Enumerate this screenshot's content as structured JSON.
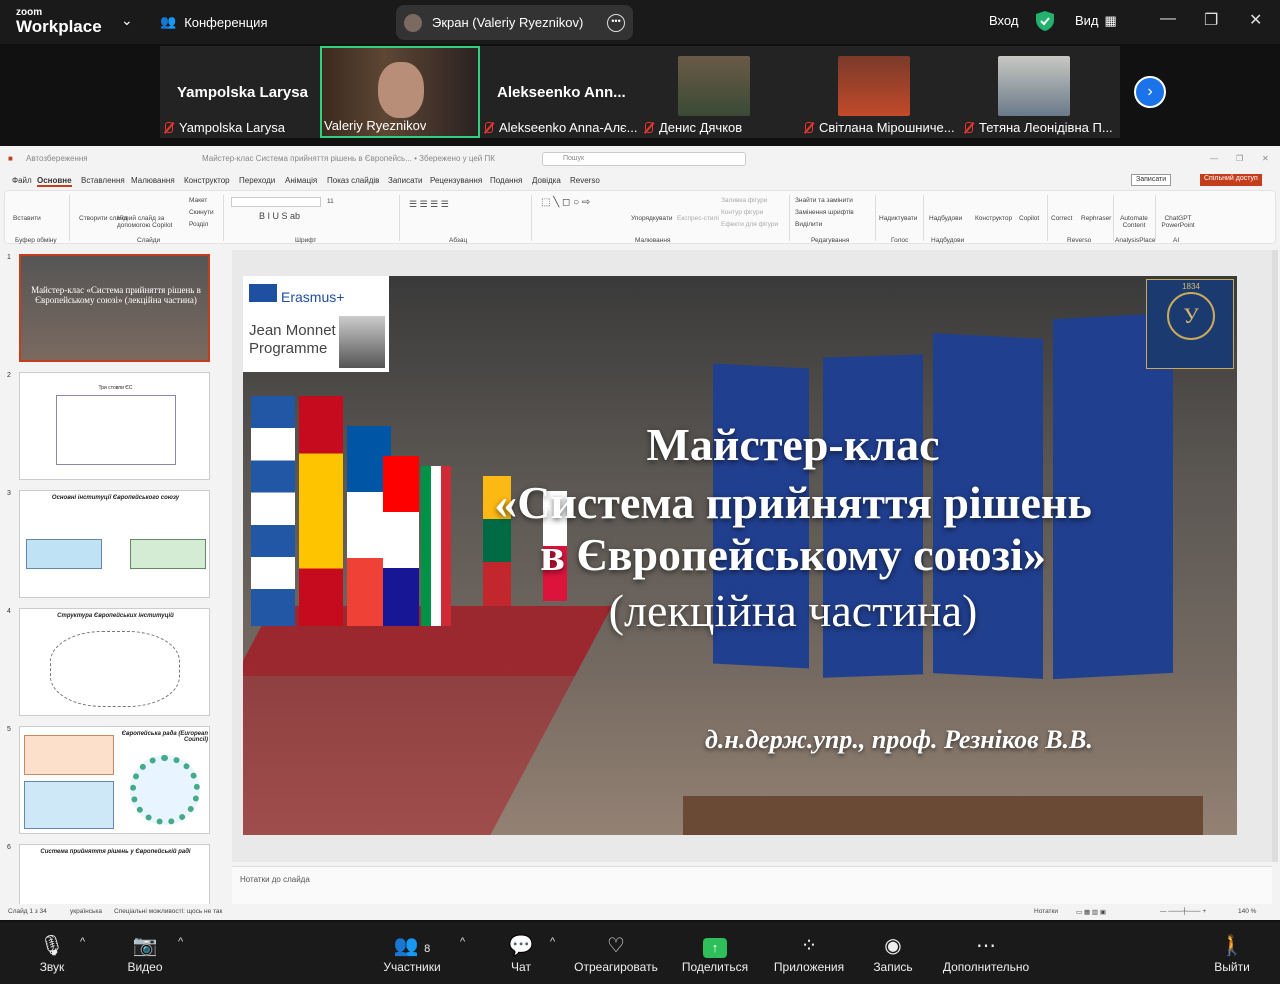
{
  "zoom": {
    "logo_top": "zoom",
    "logo_bottom": "Workplace",
    "conference_label": "Конференция",
    "screen_label": "Экран (Valeriy Ryeznikov)",
    "login_label": "Вход",
    "view_label": "Вид",
    "participants": [
      {
        "name_big": "Yampolska Larysa",
        "label": "Yampolska Larysa"
      },
      {
        "name_big": "",
        "label": "Valeriy Ryeznikov"
      },
      {
        "name_big": "Alekseenko  Ann...",
        "label": "Alekseenko Anna-Алє..."
      },
      {
        "name_big": "",
        "label": "Денис Дячков"
      },
      {
        "name_big": "",
        "label": "Світлана Мірошниче..."
      },
      {
        "name_big": "",
        "label": "Тетяна Леонідівна П..."
      }
    ],
    "toolbar": {
      "audio": "Звук",
      "video": "Видео",
      "participants": "Участники",
      "participants_count": "8",
      "chat": "Чат",
      "react": "Отреагировать",
      "share": "Поделиться",
      "apps": "Приложения",
      "record": "Запись",
      "more": "Дополнительно",
      "leave": "Выйти"
    }
  },
  "ppt": {
    "autosave": "Автозбереження",
    "doc_title": "Майстер-клас Система прийняття рішень в Європейсь... • Збережено у цей ПК",
    "search_placeholder": "Пошук",
    "menu": [
      "Файл",
      "Основне",
      "Вставлення",
      "Малювання",
      "Конструктор",
      "Переходи",
      "Анімація",
      "Показ слайдів",
      "Записати",
      "Рецензування",
      "Подання",
      "Довідка",
      "Reverso"
    ],
    "record_btn": "Записати",
    "share_btn": "Спільний доступ",
    "ribbon_groups": [
      "Буфер обміну",
      "Слайди",
      "Шрифт",
      "Абзац",
      "Малювання",
      "Редагування",
      "Голос",
      "Надбудови",
      "Reverso",
      "AnalysisPlace",
      "AI"
    ],
    "ribbon_buttons": [
      "Вставити",
      "Створити слайд",
      "Новий слайд за допомогою Copilot",
      "Макет",
      "Скинути",
      "Розділ",
      "Упорядкувати",
      "Експрес-стилі",
      "Заливка фігури",
      "Контур фігури",
      "Ефекти для фігури",
      "Знайти та замінити",
      "Замінення шрифтів",
      "Виділити",
      "Надиктувати",
      "Надбудови",
      "Конструктор",
      "Copilot",
      "Correct",
      "Rephraser",
      "Automate Content",
      "ChatGPT PowerPoint"
    ],
    "font_size": "11",
    "slide_numbers": [
      "1",
      "2",
      "3",
      "4",
      "5",
      "6"
    ],
    "thumb_titles": [
      "Майстер-клас «Система прийняття рішень в Європейському союзі» (лекційна частина)",
      "Три стовпи ЄС",
      "Основні інституції Європейського союзу",
      "Структура Європейських інституцій",
      "Європейська рада (European Council)",
      "Система прийняття рішень у Європейській раді"
    ],
    "notes_placeholder": "Нотатки до слайда",
    "status_slide": "Слайд 1 з 34",
    "status_lang": "українська",
    "status_access": "Спеціальні можливості: щось не так",
    "status_notes": "Нотатки",
    "zoom_level": "140 %"
  },
  "slide": {
    "erasmus": "Erasmus+",
    "jean_monnet": "Jean Monnet",
    "programme": "Programme",
    "crest_year": "1834",
    "crest_letter": "У",
    "title_line1": "Майстер-клас",
    "title_line2": "«Система прийняття рішень",
    "title_line3": "в Європейському союзі»",
    "title_line4": "(лекційна частина)",
    "author": "д.н.держ.упр., проф. Резніков В.В."
  }
}
